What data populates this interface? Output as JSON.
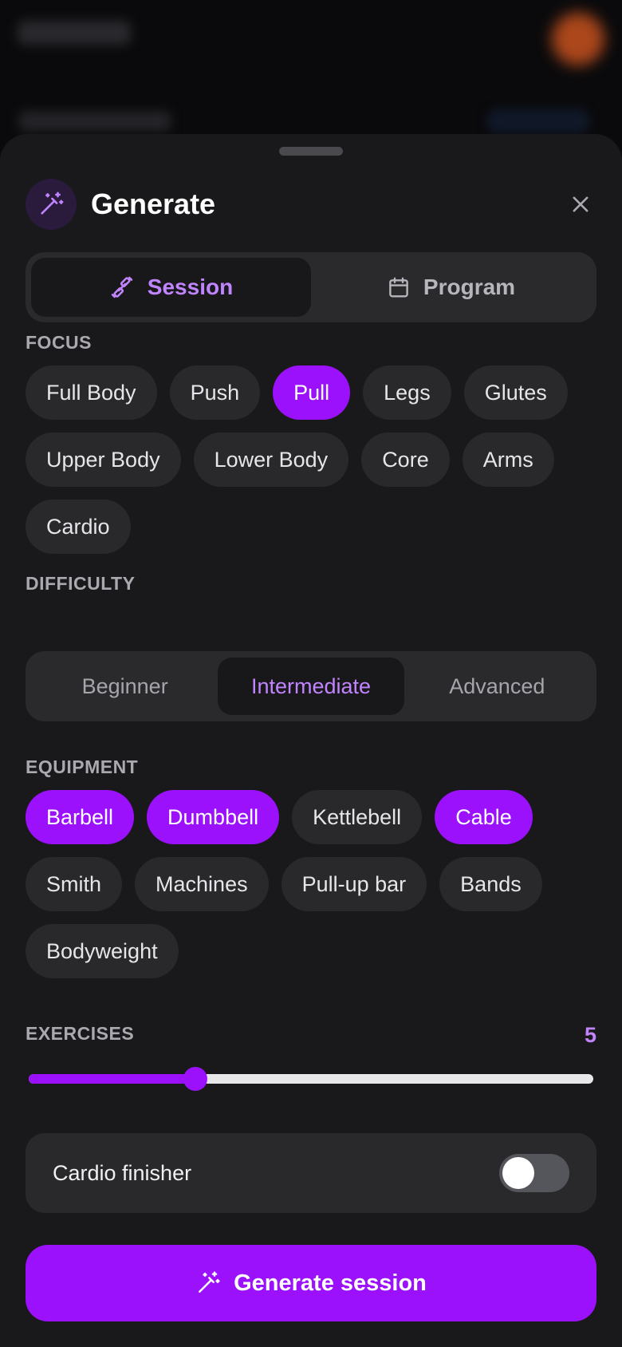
{
  "sheet": {
    "title": "Generate",
    "mode_tabs": [
      {
        "label": "Session",
        "icon": "dumbbell-icon",
        "active": true
      },
      {
        "label": "Program",
        "icon": "calendar-icon",
        "active": false
      }
    ]
  },
  "focus": {
    "label": "FOCUS",
    "options": [
      {
        "label": "Full Body",
        "selected": false
      },
      {
        "label": "Push",
        "selected": false
      },
      {
        "label": "Pull",
        "selected": true
      },
      {
        "label": "Legs",
        "selected": false
      },
      {
        "label": "Glutes",
        "selected": false
      },
      {
        "label": "Upper Body",
        "selected": false
      },
      {
        "label": "Lower Body",
        "selected": false
      },
      {
        "label": "Core",
        "selected": false
      },
      {
        "label": "Arms",
        "selected": false
      },
      {
        "label": "Cardio",
        "selected": false
      }
    ]
  },
  "difficulty": {
    "label": "DIFFICULTY",
    "options": [
      "Beginner",
      "Intermediate",
      "Advanced"
    ],
    "selected": "Intermediate"
  },
  "equipment": {
    "label": "EQUIPMENT",
    "options": [
      {
        "label": "Barbell",
        "selected": true
      },
      {
        "label": "Dumbbell",
        "selected": true
      },
      {
        "label": "Kettlebell",
        "selected": false
      },
      {
        "label": "Cable",
        "selected": true
      },
      {
        "label": "Smith",
        "selected": false
      },
      {
        "label": "Machines",
        "selected": false
      },
      {
        "label": "Pull-up bar",
        "selected": false
      },
      {
        "label": "Bands",
        "selected": false
      },
      {
        "label": "Bodyweight",
        "selected": false
      }
    ]
  },
  "exercises": {
    "label": "EXERCISES",
    "value": "5",
    "slider_fraction": 0.295
  },
  "cardio_finisher": {
    "label": "Cardio finisher",
    "enabled": false
  },
  "generate_button": {
    "label": "Generate session",
    "icon": "magic-wand-icon"
  },
  "colors": {
    "accent": "#9b11fb",
    "accent_text": "#c184ff",
    "sheet_bg": "#19191b",
    "chip_bg": "#29292c"
  }
}
